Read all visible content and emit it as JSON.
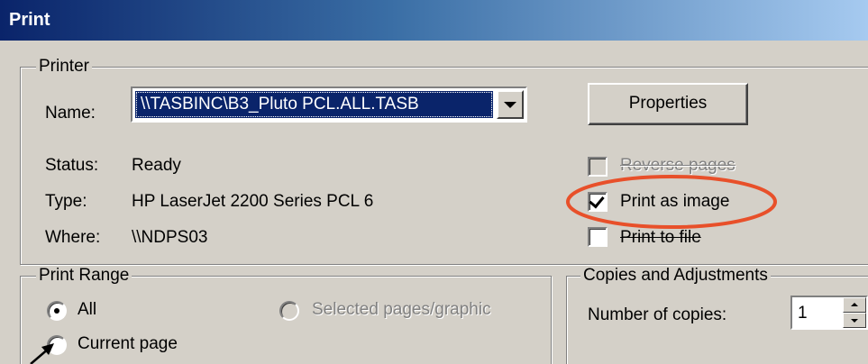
{
  "window": {
    "title": "Print"
  },
  "printer_group": {
    "legend": "Printer",
    "name_label": "Name:",
    "name_value": "\\\\TASBINC\\B3_Pluto PCL.ALL.TASB",
    "properties_label": "Properties",
    "status_label": "Status:",
    "status_value": "Ready",
    "type_label": "Type:",
    "type_value": "HP LaserJet 2200 Series PCL 6",
    "where_label": "Where:",
    "where_value": "\\\\NDPS03",
    "reverse_pages_label": "Reverse pages",
    "reverse_pages_checked": false,
    "reverse_pages_enabled": false,
    "print_as_image_label": "Print as image",
    "print_as_image_checked": true,
    "print_to_file_label": "Print to file",
    "print_to_file_checked": false
  },
  "print_range_group": {
    "legend": "Print Range",
    "all_label": "All",
    "all_selected": true,
    "selected_pages_label": "Selected pages/graphic",
    "selected_pages_enabled": false,
    "current_page_label": "Current page"
  },
  "copies_group": {
    "legend": "Copies and Adjustments",
    "number_of_copies_label": "Number of copies:",
    "number_of_copies_value": "1"
  },
  "annotations": {
    "highlight_color": "#e8502a",
    "arrow_color": "#000000"
  },
  "colors": {
    "title_bar_start": "#0a246a",
    "title_bar_end": "#a6caf0",
    "dialog_face": "#d4d0c8",
    "selection": "#0a246a"
  }
}
